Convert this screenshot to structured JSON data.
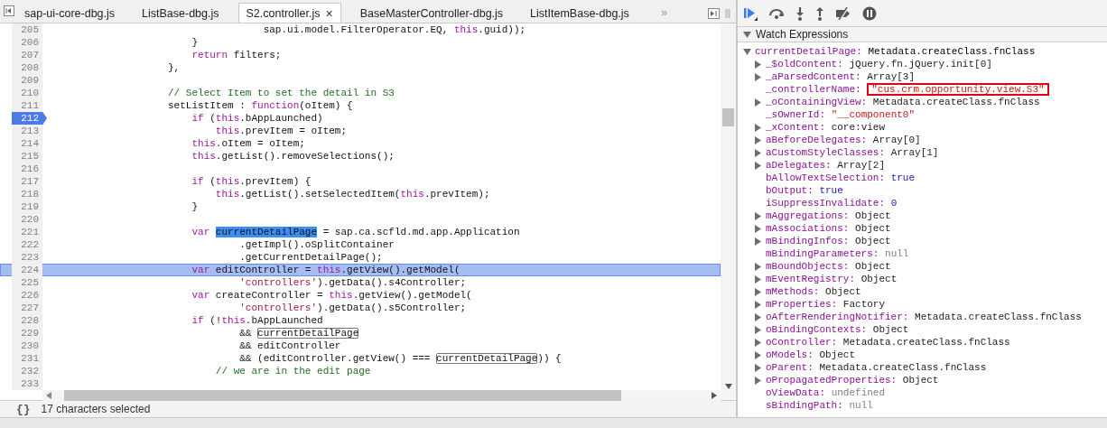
{
  "editor": {
    "tabs": [
      {
        "label": "sap-ui-core-dbg.js",
        "selected": false
      },
      {
        "label": "ListBase-dbg.js",
        "selected": false
      },
      {
        "label": "S2.controller.js",
        "selected": true
      },
      {
        "label": "BaseMasterController-dbg.js",
        "selected": false
      },
      {
        "label": "ListItemBase-dbg.js",
        "selected": false
      }
    ],
    "close_glyph": "×",
    "overflow": "»",
    "lines": [
      {
        "number": "205",
        "breakpoint": false,
        "paused": false,
        "tokens": [
          {
            "text": "                                    sap.ui.model.FilterOperator.EQ, ",
            "kind": "plain"
          },
          {
            "text": "this",
            "kind": "keyword"
          },
          {
            "text": ".guid));",
            "kind": "plain"
          }
        ]
      },
      {
        "number": "206",
        "breakpoint": false,
        "paused": false,
        "tokens": [
          {
            "text": "                        }",
            "kind": "plain"
          }
        ]
      },
      {
        "number": "207",
        "breakpoint": false,
        "paused": false,
        "tokens": [
          {
            "text": "                        return",
            "kind": "keyword"
          },
          {
            "text": " filters;",
            "kind": "plain"
          }
        ]
      },
      {
        "number": "208",
        "breakpoint": false,
        "paused": false,
        "tokens": [
          {
            "text": "                    },",
            "kind": "plain"
          }
        ]
      },
      {
        "number": "209",
        "breakpoint": false,
        "paused": false
      },
      {
        "number": "210",
        "breakpoint": false,
        "paused": false,
        "tokens": [
          {
            "text": "                    // Select Item to set the detail in S3",
            "kind": "comment"
          }
        ]
      },
      {
        "number": "211",
        "breakpoint": false,
        "paused": false,
        "tokens": [
          {
            "text": "                    setListItem : ",
            "kind": "plain"
          },
          {
            "text": "function",
            "kind": "keyword"
          },
          {
            "text": "(oItem) {",
            "kind": "plain"
          }
        ]
      },
      {
        "number": "212",
        "breakpoint": true,
        "paused": false,
        "tokens": [
          {
            "text": "                        if",
            "kind": "keyword"
          },
          {
            "text": " (",
            "kind": "plain"
          },
          {
            "text": "this",
            "kind": "keyword"
          },
          {
            "text": ".bAppLaunched)",
            "kind": "plain"
          }
        ]
      },
      {
        "number": "213",
        "breakpoint": false,
        "paused": false,
        "tokens": [
          {
            "text": "                            this",
            "kind": "keyword"
          },
          {
            "text": ".prevItem = oItem;",
            "kind": "plain"
          }
        ]
      },
      {
        "number": "214",
        "breakpoint": false,
        "paused": false,
        "tokens": [
          {
            "text": "                        this",
            "kind": "keyword"
          },
          {
            "text": ".oItem = oItem;",
            "kind": "plain"
          }
        ]
      },
      {
        "number": "215",
        "breakpoint": false,
        "paused": false,
        "tokens": [
          {
            "text": "                        this",
            "kind": "keyword"
          },
          {
            "text": ".getList().removeSelections();",
            "kind": "plain"
          }
        ]
      },
      {
        "number": "216",
        "breakpoint": false,
        "paused": false
      },
      {
        "number": "217",
        "breakpoint": false,
        "paused": false,
        "tokens": [
          {
            "text": "                        if",
            "kind": "keyword"
          },
          {
            "text": " (",
            "kind": "plain"
          },
          {
            "text": "this",
            "kind": "keyword"
          },
          {
            "text": ".prevItem) {",
            "kind": "plain"
          }
        ]
      },
      {
        "number": "218",
        "breakpoint": false,
        "paused": false,
        "tokens": [
          {
            "text": "                            this",
            "kind": "keyword"
          },
          {
            "text": ".getList().setSelectedItem(",
            "kind": "plain"
          },
          {
            "text": "this",
            "kind": "keyword"
          },
          {
            "text": ".prevItem);",
            "kind": "plain"
          }
        ]
      },
      {
        "number": "219",
        "breakpoint": false,
        "paused": false,
        "tokens": [
          {
            "text": "                        }",
            "kind": "plain"
          }
        ]
      },
      {
        "number": "220",
        "breakpoint": false,
        "paused": false
      },
      {
        "number": "221",
        "breakpoint": false,
        "paused": false,
        "tokens": [
          {
            "text": "                        var ",
            "kind": "keyword"
          },
          {
            "text": "currentDetailPage",
            "kind": "selected"
          },
          {
            "text": " = sap.ca.scfld.md.app.Application",
            "kind": "plain"
          }
        ]
      },
      {
        "number": "222",
        "breakpoint": false,
        "paused": false,
        "tokens": [
          {
            "text": "                                .getImpl().oSplitContainer",
            "kind": "plain"
          }
        ]
      },
      {
        "number": "223",
        "breakpoint": false,
        "paused": false,
        "tokens": [
          {
            "text": "                                .getCurrentDetailPage();",
            "kind": "plain"
          }
        ]
      },
      {
        "number": "224",
        "breakpoint": false,
        "paused": true,
        "tokens": [
          {
            "text": "                        var",
            "kind": "keyword"
          },
          {
            "text": " editController = ",
            "kind": "plain"
          },
          {
            "text": "this",
            "kind": "keyword"
          },
          {
            "text": ".getView().getModel(",
            "kind": "plain"
          }
        ]
      },
      {
        "number": "225",
        "breakpoint": false,
        "paused": false,
        "tokens": [
          {
            "text": "                                'controllers'",
            "kind": "string"
          },
          {
            "text": ").getData().s4Controller;",
            "kind": "plain"
          }
        ]
      },
      {
        "number": "226",
        "breakpoint": false,
        "paused": false,
        "tokens": [
          {
            "text": "                        var",
            "kind": "keyword"
          },
          {
            "text": " createController = ",
            "kind": "plain"
          },
          {
            "text": "this",
            "kind": "keyword"
          },
          {
            "text": ".getView().getModel(",
            "kind": "plain"
          }
        ]
      },
      {
        "number": "227",
        "breakpoint": false,
        "paused": false,
        "tokens": [
          {
            "text": "                                'controllers'",
            "kind": "string"
          },
          {
            "text": ").getData().s5Controller;",
            "kind": "plain"
          }
        ]
      },
      {
        "number": "228",
        "breakpoint": false,
        "paused": false,
        "tokens": [
          {
            "text": "                        if",
            "kind": "keyword"
          },
          {
            "text": " (!",
            "kind": "plain"
          },
          {
            "text": "this",
            "kind": "keyword"
          },
          {
            "text": ".bAppLaunched",
            "kind": "plain"
          }
        ]
      },
      {
        "number": "229",
        "breakpoint": false,
        "paused": false,
        "tokens": [
          {
            "text": "                                && ",
            "kind": "plain"
          },
          {
            "text": "currentDetailPage",
            "kind": "boxed"
          }
        ]
      },
      {
        "number": "230",
        "breakpoint": false,
        "paused": false,
        "tokens": [
          {
            "text": "                                && editController",
            "kind": "plain"
          }
        ]
      },
      {
        "number": "231",
        "breakpoint": false,
        "paused": false,
        "tokens": [
          {
            "text": "                                && (editController.getView() === ",
            "kind": "plain"
          },
          {
            "text": "currentDetailPage",
            "kind": "boxed"
          },
          {
            "text": ")) {",
            "kind": "plain"
          }
        ]
      },
      {
        "number": "232",
        "breakpoint": false,
        "paused": false,
        "tokens": [
          {
            "text": "                            // we are in the edit page",
            "kind": "comment"
          }
        ]
      },
      {
        "number": "233",
        "breakpoint": false,
        "paused": false
      }
    ],
    "status": {
      "format_button": "{}",
      "text": "17 characters selected"
    }
  },
  "watch": {
    "title": "Watch Expressions",
    "expanded": true,
    "root": {
      "name": "currentDetailPage:",
      "value": "Metadata.createClass.fnClass",
      "expanded": true
    },
    "children": [
      {
        "name": "_$oldContent:",
        "value": "jQuery.fn.jQuery.init[0]",
        "kind": "object",
        "expandable": true,
        "highlighted": false
      },
      {
        "name": "_aParsedContent:",
        "value": "Array[3]",
        "kind": "object",
        "expandable": true,
        "highlighted": false
      },
      {
        "name": "_controllerName:",
        "value": "\"cus.crm.opportunity.view.S3\"",
        "kind": "string",
        "expandable": false,
        "highlighted": true
      },
      {
        "name": "_oContainingView:",
        "value": "Metadata.createClass.fnClass",
        "kind": "object",
        "expandable": true,
        "highlighted": false
      },
      {
        "name": "_sOwnerId:",
        "value": "\"__component0\"",
        "kind": "string",
        "expandable": false,
        "highlighted": false
      },
      {
        "name": "_xContent:",
        "value": "core:view",
        "kind": "object",
        "expandable": true,
        "highlighted": false
      },
      {
        "name": "aBeforeDelegates:",
        "value": "Array[0]",
        "kind": "object",
        "expandable": true,
        "highlighted": false
      },
      {
        "name": "aCustomStyleClasses:",
        "value": "Array[1]",
        "kind": "object",
        "expandable": true,
        "highlighted": false
      },
      {
        "name": "aDelegates:",
        "value": "Array[2]",
        "kind": "object",
        "expandable": true,
        "highlighted": false
      },
      {
        "name": "bAllowTextSelection:",
        "value": "true",
        "kind": "keyword",
        "expandable": false,
        "highlighted": false
      },
      {
        "name": "bOutput:",
        "value": "true",
        "kind": "keyword",
        "expandable": false,
        "highlighted": false
      },
      {
        "name": "iSuppressInvalidate:",
        "value": "0",
        "kind": "keyword",
        "expandable": false,
        "highlighted": false
      },
      {
        "name": "mAggregations:",
        "value": "Object",
        "kind": "object",
        "expandable": true,
        "highlighted": false
      },
      {
        "name": "mAssociations:",
        "value": "Object",
        "kind": "object",
        "expandable": true,
        "highlighted": false
      },
      {
        "name": "mBindingInfos:",
        "value": "Object",
        "kind": "object",
        "expandable": true,
        "highlighted": false
      },
      {
        "name": "mBindingParameters:",
        "value": "null",
        "kind": "null",
        "expandable": false,
        "highlighted": false
      },
      {
        "name": "mBoundObjects:",
        "value": "Object",
        "kind": "object",
        "expandable": true,
        "highlighted": false
      },
      {
        "name": "mEventRegistry:",
        "value": "Object",
        "kind": "object",
        "expandable": true,
        "highlighted": false
      },
      {
        "name": "mMethods:",
        "value": "Object",
        "kind": "object",
        "expandable": true,
        "highlighted": false
      },
      {
        "name": "mProperties:",
        "value": "Factory",
        "kind": "object",
        "expandable": true,
        "highlighted": false
      },
      {
        "name": "oAfterRenderingNotifier:",
        "value": "Metadata.createClass.fnClass",
        "kind": "object",
        "expandable": true,
        "highlighted": false
      },
      {
        "name": "oBindingContexts:",
        "value": "Object",
        "kind": "object",
        "expandable": true,
        "highlighted": false
      },
      {
        "name": "oController:",
        "value": "Metadata.createClass.fnClass",
        "kind": "object",
        "expandable": true,
        "highlighted": false
      },
      {
        "name": "oModels:",
        "value": "Object",
        "kind": "object",
        "expandable": true,
        "highlighted": false
      },
      {
        "name": "oParent:",
        "value": "Metadata.createClass.fnClass",
        "kind": "object",
        "expandable": true,
        "highlighted": false
      },
      {
        "name": "oPropagatedProperties:",
        "value": "Object",
        "kind": "object",
        "expandable": true,
        "highlighted": false
      },
      {
        "name": "oViewData:",
        "value": "undefined",
        "kind": "null",
        "expandable": false,
        "highlighted": false
      },
      {
        "name": "sBindingPath:",
        "value": "null",
        "kind": "null",
        "expandable": false,
        "highlighted": false
      }
    ]
  }
}
